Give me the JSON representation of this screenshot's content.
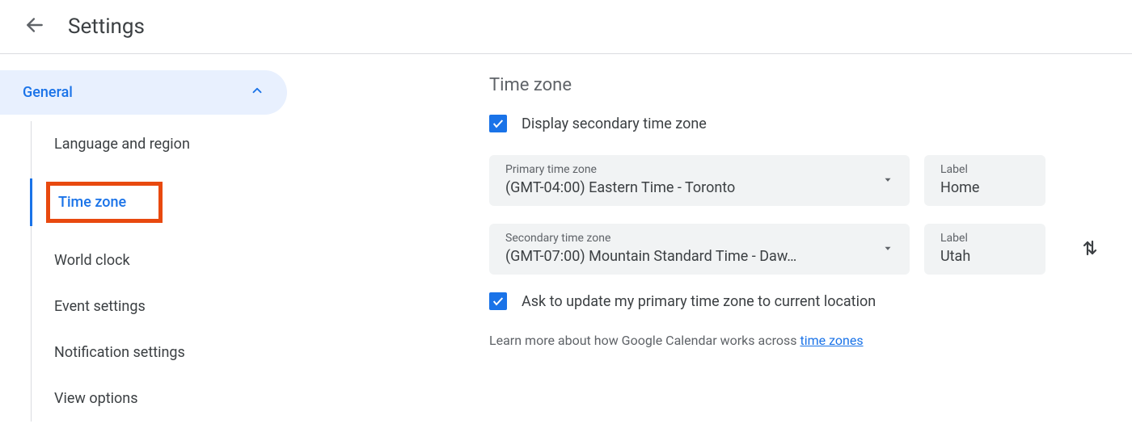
{
  "header": {
    "title": "Settings"
  },
  "sidebar": {
    "group_label": "General",
    "items": [
      {
        "label": "Language and region",
        "active": false
      },
      {
        "label": "Time zone",
        "active": true
      },
      {
        "label": "World clock",
        "active": false
      },
      {
        "label": "Event settings",
        "active": false
      },
      {
        "label": "Notification settings",
        "active": false
      },
      {
        "label": "View options",
        "active": false
      }
    ]
  },
  "timezone": {
    "section_title": "Time zone",
    "display_secondary_label": "Display secondary time zone",
    "display_secondary_checked": true,
    "primary": {
      "field_label": "Primary time zone",
      "value": "(GMT-04:00) Eastern Time - Toronto",
      "label_field": "Label",
      "label_value": "Home"
    },
    "secondary": {
      "field_label": "Secondary time zone",
      "value": "(GMT-07:00) Mountain Standard Time - Daw…",
      "label_field": "Label",
      "label_value": "Utah"
    },
    "ask_update_label": "Ask to update my primary time zone to current location",
    "ask_update_checked": true,
    "learn_more_prefix": "Learn more about how Google Calendar works across ",
    "learn_more_link": "time zones"
  }
}
